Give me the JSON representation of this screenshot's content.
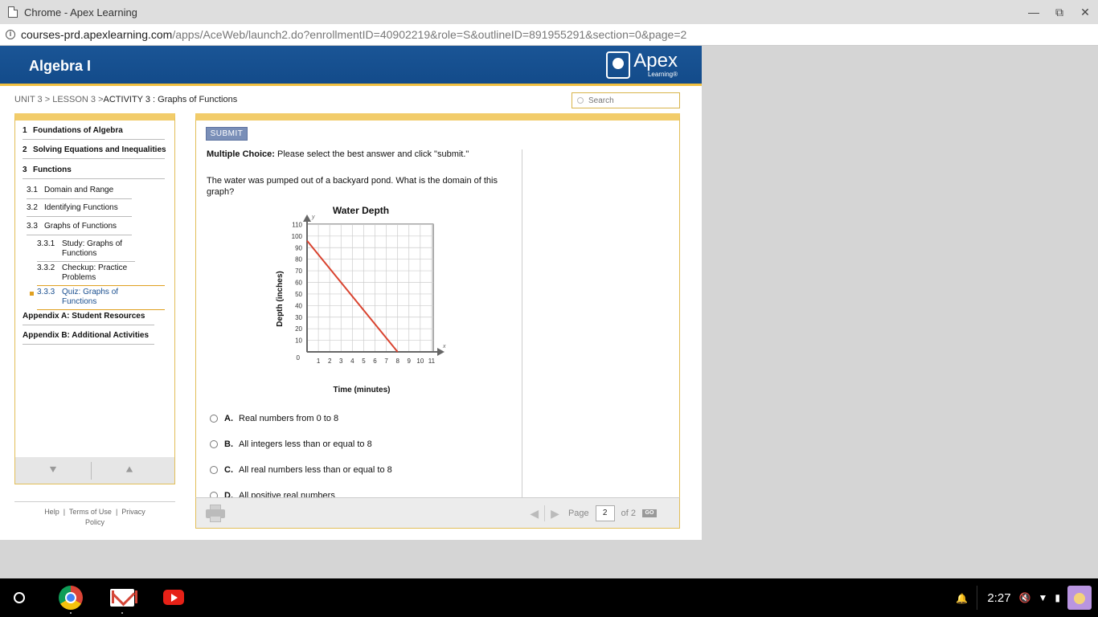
{
  "window": {
    "title": "Chrome - Apex Learning",
    "min_label": "—",
    "max_label": "⧉",
    "close_label": "✕"
  },
  "url": {
    "host": "courses-prd.apexlearning.com",
    "path": "/apps/AceWeb/launch2.do?enrollmentID=40902219&role=S&outlineID=891955291&section=0&page=2"
  },
  "header": {
    "course": "Algebra I",
    "logo_word": "Apex",
    "logo_sub": "Learning®"
  },
  "breadcrumb": {
    "unit": "UNIT 3",
    "lesson": "LESSON 3",
    "activity": "ACTIVITY 3 : Graphs of Functions",
    "sep": ">"
  },
  "search": {
    "placeholder": "Search"
  },
  "sidebar": {
    "items": [
      {
        "num": "1",
        "label": "Foundations of Algebra"
      },
      {
        "num": "2",
        "label": "Solving Equations and Inequalities"
      },
      {
        "num": "3",
        "label": "Functions"
      },
      {
        "num": "3.1",
        "label": "Domain and Range"
      },
      {
        "num": "3.2",
        "label": "Identifying Functions"
      },
      {
        "num": "3.3",
        "label": "Graphs of Functions"
      },
      {
        "num": "3.3.1",
        "label1": "Study: Graphs of",
        "label2": "Functions"
      },
      {
        "num": "3.3.2",
        "label1": "Checkup: Practice",
        "label2": "Problems"
      },
      {
        "num": "3.3.3",
        "label1": "Quiz: Graphs of",
        "label2": "Functions"
      },
      {
        "label": "Appendix A: Student Resources"
      },
      {
        "label": "Appendix B: Additional Activities"
      }
    ],
    "down_arrow": "⯆",
    "up_arrow": "⯅"
  },
  "footer_links": {
    "help": "Help",
    "terms": "Terms of Use",
    "privacy1": "Privacy",
    "privacy2": "Policy",
    "sep": "|"
  },
  "question": {
    "submit_label": "SUBMIT",
    "mc_prefix": "Multiple Choice:",
    "mc_instructions": "Please select the best answer and click \"submit.\"",
    "text": "The water was pumped out of a backyard pond. What is the domain of this graph?",
    "options": [
      {
        "letter": "A.",
        "text": "Real numbers from 0 to 8"
      },
      {
        "letter": "B.",
        "text": "All integers less than or equal to 8"
      },
      {
        "letter": "C.",
        "text": "All real numbers less than or equal to 8"
      },
      {
        "letter": "D.",
        "text": "All positive real numbers"
      }
    ]
  },
  "chart_data": {
    "type": "line",
    "title": "Water Depth",
    "xlabel": "Time (minutes)",
    "ylabel": "Depth (inches)",
    "x_axis_letter": "x",
    "y_axis_letter": "y",
    "origin_label": "0",
    "xlim": [
      0,
      12
    ],
    "ylim": [
      0,
      120
    ],
    "x_ticks": [
      1,
      2,
      3,
      4,
      5,
      6,
      7,
      8,
      9,
      10,
      11
    ],
    "y_ticks": [
      10,
      20,
      30,
      40,
      50,
      60,
      70,
      80,
      90,
      100,
      110
    ],
    "grid": true,
    "series": [
      {
        "x": [
          0,
          8
        ],
        "y": [
          96,
          0
        ],
        "color": "#d9432f"
      }
    ]
  },
  "pager": {
    "page_label": "Page",
    "current": "2",
    "of_label": "of 2",
    "go_label": "GO",
    "prev_arrow": "◀",
    "next_arrow": "▶"
  },
  "taskbar": {
    "clock": "2:27",
    "bell": "🔔",
    "mute": "🔇",
    "wifi": "▼",
    "battery": "▮"
  }
}
